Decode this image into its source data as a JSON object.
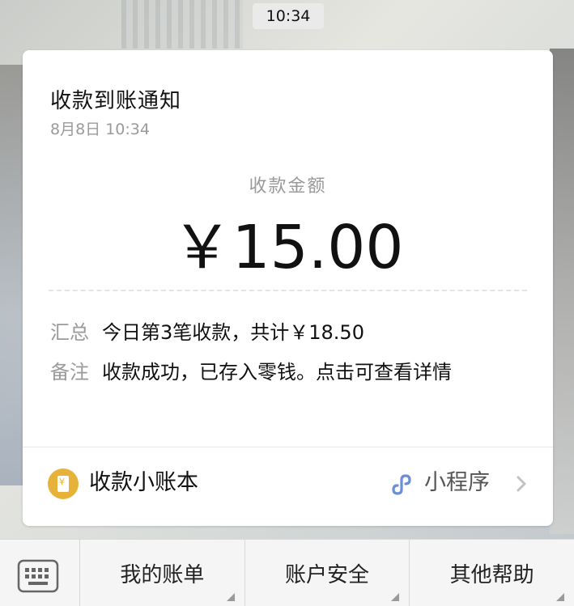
{
  "status": {
    "time": "10:34"
  },
  "card": {
    "title": "收款到账通知",
    "date": "8月8日  10:34",
    "amount_label": "收款金额",
    "amount_value": "￥15.00",
    "rows": [
      {
        "label": "汇总",
        "value": "今日第3笔收款，共计￥18.50"
      },
      {
        "label": "备注",
        "value": "收款成功，已存入零钱。点击可查看详情"
      }
    ],
    "footer": {
      "app_name": "收款小账本",
      "mini_program_label": "小程序"
    }
  },
  "bottom_menu": {
    "keyboard_icon": "keyboard-icon",
    "items": [
      {
        "label": "我的账单"
      },
      {
        "label": "账户安全"
      },
      {
        "label": "其他帮助"
      }
    ]
  },
  "colors": {
    "ledger_icon": "#e7b23a",
    "mini_program_icon": "#6c8fd6",
    "secondary_text": "#9a9a9a"
  }
}
